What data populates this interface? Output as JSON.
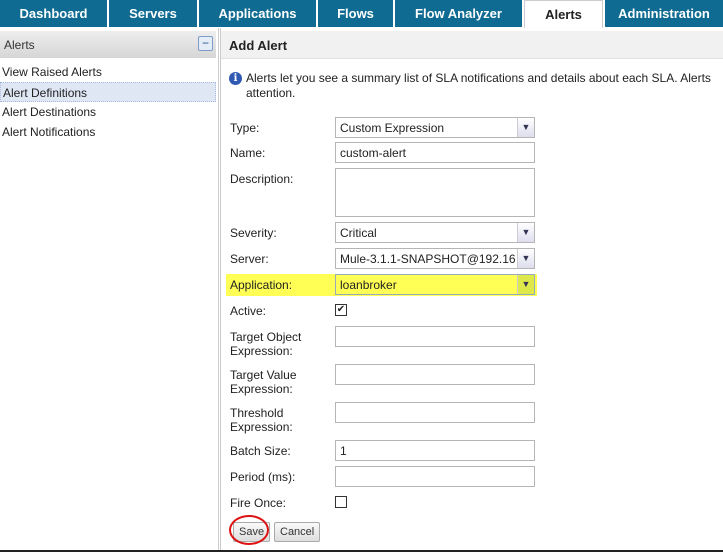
{
  "tabs": [
    "Dashboard",
    "Servers",
    "Applications",
    "Flows",
    "Flow Analyzer",
    "Alerts",
    "Administration"
  ],
  "active_tab": "Alerts",
  "sidebar": {
    "title": "Alerts",
    "collapse_icon": "minus-icon",
    "items": [
      "View Raised Alerts",
      "Alert Definitions",
      "Alert Destinations",
      "Alert Notifications"
    ],
    "selected": "Alert Definitions"
  },
  "main": {
    "title": "Add Alert",
    "info": "Alerts let you see a summary list of SLA notifications and details about each SLA. Alerts",
    "info_cont": "attention."
  },
  "form": {
    "type_label": "Type:",
    "type_value": "Custom Expression",
    "name_label": "Name:",
    "name_value": "custom-alert",
    "description_label": "Description:",
    "description_value": "",
    "severity_label": "Severity:",
    "severity_value": "Critical",
    "server_label": "Server:",
    "server_value": "Mule-3.1.1-SNAPSHOT@192.16",
    "application_label": "Application:",
    "application_value": "loanbroker",
    "active_label": "Active:",
    "active_checked": true,
    "target_object_label1": "Target Object",
    "target_object_label2": "Expression:",
    "target_object_value": "",
    "target_value_label1": "Target Value",
    "target_value_label2": "Expression:",
    "target_value_value": "",
    "threshold_label1": "Threshold",
    "threshold_label2": "Expression:",
    "threshold_value": "",
    "batch_label": "Batch Size:",
    "batch_value": "1",
    "period_label": "Period (ms):",
    "period_value": "",
    "fire_once_label": "Fire Once:",
    "fire_once_checked": false,
    "save": "Save",
    "cancel": "Cancel"
  },
  "colors": {
    "tab_bg": "#0f6b91",
    "highlight": "#ffff55",
    "annotation_ring": "#d11111"
  }
}
